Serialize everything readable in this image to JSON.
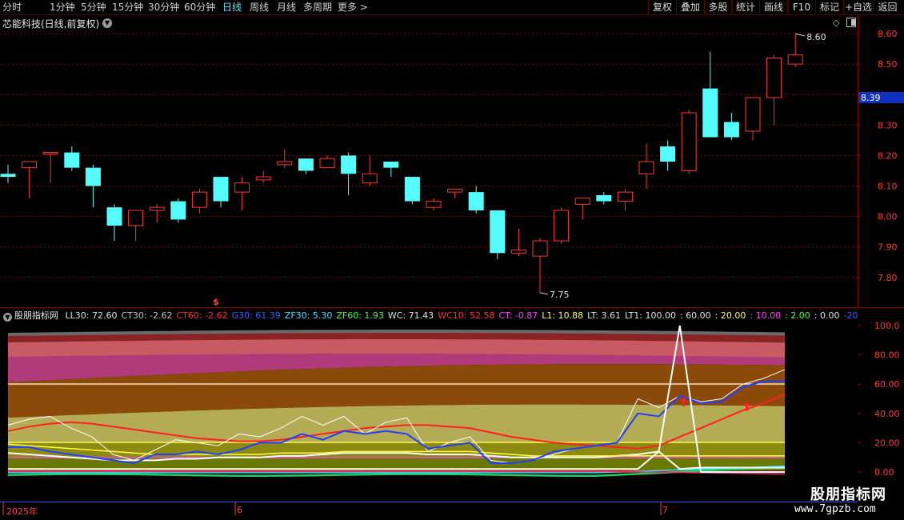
{
  "periods": [
    "分时",
    "1分钟",
    "5分钟",
    "15分钟",
    "30分钟",
    "60分钟",
    "日线",
    "周线",
    "月线",
    "多周期",
    "更多 >"
  ],
  "active_period": "日线",
  "tools": [
    "复权",
    "叠加",
    "多股",
    "统计",
    "画线",
    "F10",
    "标记",
    "+自选",
    "返回"
  ],
  "stock_title": "芯能科技(日线,前复权)",
  "price_axis": [
    "8.60",
    "8.50",
    "8.40",
    "8.30",
    "8.20",
    "8.10",
    "8.00",
    "7.90",
    "7.80"
  ],
  "price_axis_values": [
    8.6,
    8.5,
    8.39,
    8.3,
    8.2,
    8.1,
    8.0,
    7.9,
    7.8
  ],
  "current_price_label": "8.39",
  "current_price": 8.39,
  "high_label": "8.60",
  "low_label": "7.75",
  "candles": [
    [
      8.14,
      8.13,
      8.17,
      8.11
    ],
    [
      8.16,
      8.18,
      8.18,
      8.06
    ],
    [
      8.21,
      8.21,
      8.21,
      8.11
    ],
    [
      8.21,
      8.16,
      8.23,
      8.15
    ],
    [
      8.16,
      8.1,
      8.17,
      8.03
    ],
    [
      8.03,
      7.97,
      8.04,
      7.92
    ],
    [
      7.97,
      8.02,
      8.02,
      7.92
    ],
    [
      8.02,
      8.03,
      8.04,
      7.98
    ],
    [
      8.05,
      7.99,
      8.06,
      7.98
    ],
    [
      8.03,
      8.08,
      8.09,
      8.01
    ],
    [
      8.13,
      8.05,
      8.13,
      8.03
    ],
    [
      8.08,
      8.11,
      8.13,
      8.02
    ],
    [
      8.12,
      8.13,
      8.15,
      8.11
    ],
    [
      8.17,
      8.18,
      8.22,
      8.16
    ],
    [
      8.19,
      8.15,
      8.19,
      8.14
    ],
    [
      8.16,
      8.19,
      8.2,
      8.16
    ],
    [
      8.2,
      8.14,
      8.21,
      8.07
    ],
    [
      8.11,
      8.14,
      8.2,
      8.1
    ],
    [
      8.18,
      8.16,
      8.18,
      8.13
    ],
    [
      8.13,
      8.05,
      8.13,
      8.04
    ],
    [
      8.03,
      8.05,
      8.06,
      8.02
    ],
    [
      8.08,
      8.09,
      8.09,
      8.06
    ],
    [
      8.08,
      8.02,
      8.1,
      8.01
    ],
    [
      8.02,
      7.88,
      8.02,
      7.86
    ],
    [
      7.88,
      7.89,
      7.96,
      7.87
    ],
    [
      7.87,
      7.92,
      7.93,
      7.75
    ],
    [
      7.92,
      8.02,
      8.03,
      7.91
    ],
    [
      8.04,
      8.06,
      8.06,
      7.99
    ],
    [
      8.07,
      8.05,
      8.08,
      8.04
    ],
    [
      8.05,
      8.08,
      8.09,
      8.02
    ],
    [
      8.14,
      8.18,
      8.24,
      8.09
    ],
    [
      8.23,
      8.18,
      8.25,
      8.15
    ],
    [
      8.15,
      8.34,
      8.35,
      8.14
    ],
    [
      8.42,
      8.26,
      8.54,
      8.26
    ],
    [
      8.31,
      8.26,
      8.34,
      8.25
    ],
    [
      8.28,
      8.39,
      8.39,
      8.25
    ],
    [
      8.39,
      8.52,
      8.53,
      8.3
    ],
    [
      8.5,
      8.53,
      8.6,
      8.49
    ]
  ],
  "indicator": {
    "name": "股朋指标网",
    "items": [
      {
        "text": "LL30: 72.60",
        "color": "#e0e0e0"
      },
      {
        "text": "CT30: -2.62",
        "color": "#c0c0c0"
      },
      {
        "text": "CT60: -2.62",
        "color": "#ff3030"
      },
      {
        "text": "G30: 61.39",
        "color": "#3a5cff"
      },
      {
        "text": "ZF30: 5.30",
        "color": "#40e0ff"
      },
      {
        "text": "ZF60: 1.93",
        "color": "#40ff40"
      },
      {
        "text": "WC: 71.43",
        "color": "#e0e0e0"
      },
      {
        "text": "WC10: 52.58",
        "color": "#ff3030"
      },
      {
        "text": "CT: -0.87",
        "color": "#ff40ff"
      },
      {
        "text": "L1: 10.88",
        "color": "#ffff40"
      },
      {
        "text": "LT: 3.61",
        "color": "#e0e0e0"
      },
      {
        "text": "LT1: 100.00",
        "color": "#e0e0e0"
      },
      {
        "text": ": 60.00",
        "color": "#e0e0e0"
      },
      {
        "text": ": 20.00",
        "color": "#ffff40"
      },
      {
        "text": ": 10.00",
        "color": "#ff40ff"
      },
      {
        "text": ": 2.00",
        "color": "#40ff40"
      },
      {
        "text": ": 0.00",
        "color": "#e0e0e0"
      },
      {
        "text": "-20.",
        "color": "#3a5cff"
      }
    ],
    "axis": [
      "100.0",
      "80.00",
      "60.00",
      "40.00",
      "20.00",
      "0.00"
    ],
    "axis_values": [
      100,
      80,
      60,
      40,
      20,
      0
    ]
  },
  "x_labels": [
    {
      "text": "2025年",
      "index": 0
    },
    {
      "text": "6",
      "index": 11
    },
    {
      "text": "7",
      "index": 31
    }
  ],
  "logo": {
    "cn": "股朋指标网",
    "url": "www.7gpzb.com"
  },
  "colors": {
    "up": "#ff3333",
    "down": "#54fcfc",
    "grid": "#7a0000",
    "frame": "#8a0000"
  }
}
